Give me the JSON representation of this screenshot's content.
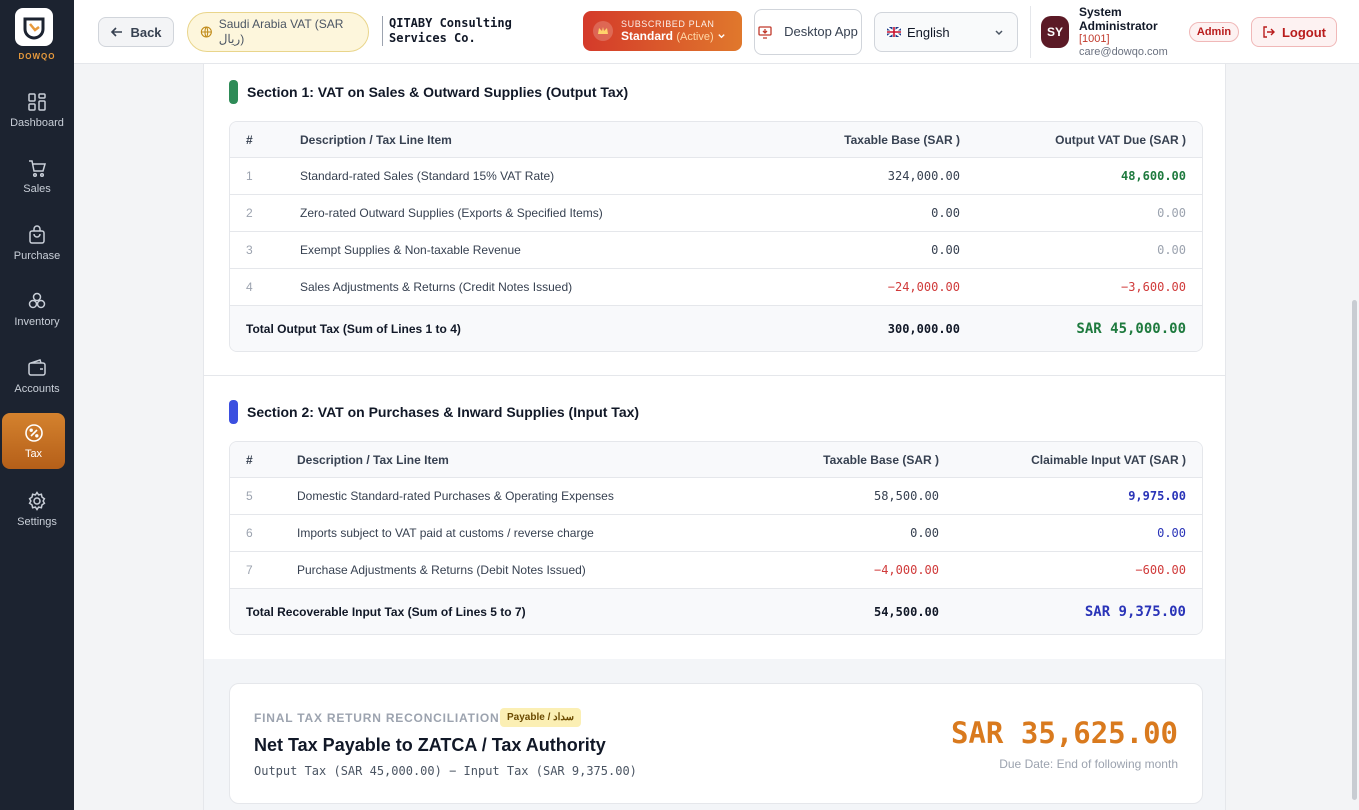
{
  "brand": {
    "name": "DOWQO"
  },
  "nav": [
    {
      "label": "Dashboard",
      "icon": "grid-icon"
    },
    {
      "label": "Sales",
      "icon": "cart-icon"
    },
    {
      "label": "Purchase",
      "icon": "bag-icon"
    },
    {
      "label": "Inventory",
      "icon": "boxes-icon"
    },
    {
      "label": "Accounts",
      "icon": "wallet-icon"
    },
    {
      "label": "Tax",
      "icon": "percent-icon",
      "active": true
    },
    {
      "label": "Settings",
      "icon": "gear-icon"
    }
  ],
  "header": {
    "back_label": "Back",
    "region_label": "Saudi Arabia VAT (SAR ريال)",
    "company_name": "QITABY Consulting Services Co.",
    "plan_caption": "SUBSCRIBED PLAN",
    "plan_name": "Standard",
    "plan_status": "(Active)",
    "desktop_app_label": "Desktop App",
    "language": "English",
    "user_initials": "SY",
    "user_name": "System Administrator",
    "user_id": "[1001]",
    "user_email": "care@dowqo.com",
    "role_badge": "Admin",
    "logout_label": "Logout"
  },
  "section1": {
    "title": "Section 1: VAT on Sales & Outward Supplies (Output Tax)",
    "accent": "#2e8b57",
    "columns": {
      "num": "#",
      "desc": "Description / Tax Line Item",
      "base": "Taxable Base (SAR )",
      "vat": "Output VAT Due (SAR )"
    },
    "rows": [
      {
        "num": "1",
        "desc": "Standard-rated Sales (Standard 15% VAT Rate)",
        "base": "324,000.00",
        "vat": "48,600.00"
      },
      {
        "num": "2",
        "desc": "Zero-rated Outward Supplies (Exports & Specified Items)",
        "base": "0.00",
        "vat": "0.00"
      },
      {
        "num": "3",
        "desc": "Exempt Supplies & Non-taxable Revenue",
        "base": "0.00",
        "vat": "0.00"
      },
      {
        "num": "4",
        "desc": "Sales Adjustments & Returns (Credit Notes Issued)",
        "base": "−24,000.00",
        "vat": "−3,600.00"
      }
    ],
    "total": {
      "desc": "Total Output Tax (Sum of Lines 1 to 4)",
      "base": "300,000.00",
      "vat": "SAR 45,000.00"
    }
  },
  "section2": {
    "title": "Section 2: VAT on Purchases & Inward Supplies (Input Tax)",
    "accent": "#3b4fe0",
    "columns": {
      "num": "#",
      "desc": "Description / Tax Line Item",
      "base": "Taxable Base (SAR )",
      "vat": "Claimable Input VAT (SAR )"
    },
    "rows": [
      {
        "num": "5",
        "desc": "Domestic Standard-rated Purchases & Operating Expenses",
        "base": "58,500.00",
        "vat": "9,975.00"
      },
      {
        "num": "6",
        "desc": "Imports subject to VAT paid at customs / reverse charge",
        "base": "0.00",
        "vat": "0.00"
      },
      {
        "num": "7",
        "desc": "Purchase Adjustments & Returns (Debit Notes Issued)",
        "base": "−4,000.00",
        "vat": "−600.00"
      }
    ],
    "total": {
      "desc": "Total Recoverable Input Tax (Sum of Lines 5 to 7)",
      "base": "54,500.00",
      "vat": "SAR 9,375.00"
    }
  },
  "final": {
    "caption": "FINAL TAX RETURN RECONCILIATION",
    "badge": "Payable / سداد",
    "title": "Net Tax Payable to ZATCA / Tax Authority",
    "formula": "Output Tax (SAR 45,000.00) − Input Tax (SAR 9,375.00)",
    "amount": "SAR 35,625.00",
    "due": "Due Date: End of following month"
  }
}
